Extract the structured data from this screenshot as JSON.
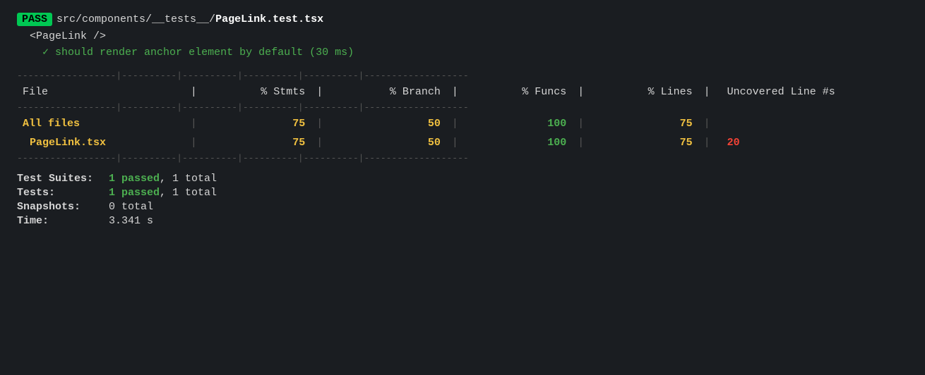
{
  "header": {
    "pass_badge": "PASS",
    "file_path_prefix": "src/components/__tests__/",
    "file_path_main": "PageLink.test.tsx",
    "suite_name": "<PageLink />",
    "test_item": "✓ should render anchor element by default (30 ms)"
  },
  "table": {
    "sep1": "------------------|----------|----------|----------|----------|-------------------",
    "col_file": "File",
    "col_stmts": "% Stmts",
    "col_branch": "% Branch",
    "col_funcs": "% Funcs",
    "col_lines": "% Lines",
    "col_uncovered": "Uncovered Line #s",
    "sep2": "------------------|----------|----------|----------|----------|-------------------",
    "rows": [
      {
        "file": "All files",
        "stmts": "75",
        "branch": "50",
        "funcs": "100",
        "lines": "75",
        "uncovered": "",
        "file_class": "yellow",
        "stmts_class": "yellow",
        "branch_class": "yellow",
        "funcs_class": "green",
        "lines_class": "yellow",
        "uncovered_class": ""
      },
      {
        "file": "PageLink.tsx",
        "stmts": "75",
        "branch": "50",
        "funcs": "100",
        "lines": "75",
        "uncovered": "20",
        "file_class": "yellow",
        "stmts_class": "yellow",
        "branch_class": "yellow",
        "funcs_class": "green",
        "lines_class": "yellow",
        "uncovered_class": "red"
      }
    ],
    "sep3": "------------------|----------|----------|----------|----------|-------------------"
  },
  "stats": {
    "suites_label": "Test Suites:",
    "suites_passed": "1 passed",
    "suites_total": ", 1 total",
    "tests_label": "Tests:",
    "tests_passed": "1 passed",
    "tests_total": ", 1 total",
    "snapshots_label": "Snapshots:",
    "snapshots_value": "0 total",
    "time_label": "Time:",
    "time_value": "3.341 s"
  }
}
